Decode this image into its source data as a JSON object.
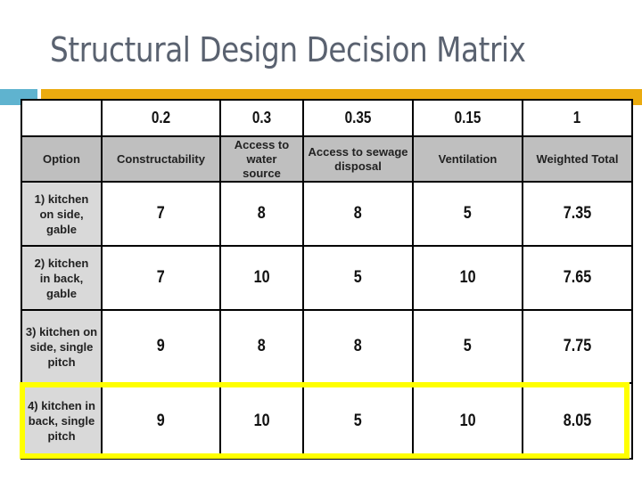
{
  "slide": {
    "title": "Structural Design Decision Matrix"
  },
  "decorations": {
    "accent_teal": "#5fb3cf",
    "accent_orange": "#ebab0f",
    "highlight_color": "#ffff00"
  },
  "matrix": {
    "weights": [
      "",
      "0.2",
      "0.3",
      "0.35",
      "0.15",
      "1"
    ],
    "headers": [
      "Option",
      "Constructability",
      "Access to water source",
      "Access to sewage disposal",
      "Ventilation",
      "Weighted Total"
    ],
    "rows": [
      {
        "option": "1) kitchen on side, gable",
        "scores": [
          "7",
          "8",
          "8",
          "5"
        ],
        "total": "7.35"
      },
      {
        "option": "2) kitchen in back, gable",
        "scores": [
          "7",
          "10",
          "5",
          "10"
        ],
        "total": "7.65"
      },
      {
        "option": "3) kitchen on side, single pitch",
        "scores": [
          "9",
          "8",
          "8",
          "5"
        ],
        "total": "7.75"
      },
      {
        "option": "4) kitchen in back, single pitch",
        "scores": [
          "9",
          "10",
          "5",
          "10"
        ],
        "total": "8.05"
      }
    ],
    "highlighted_row_index": 3
  }
}
